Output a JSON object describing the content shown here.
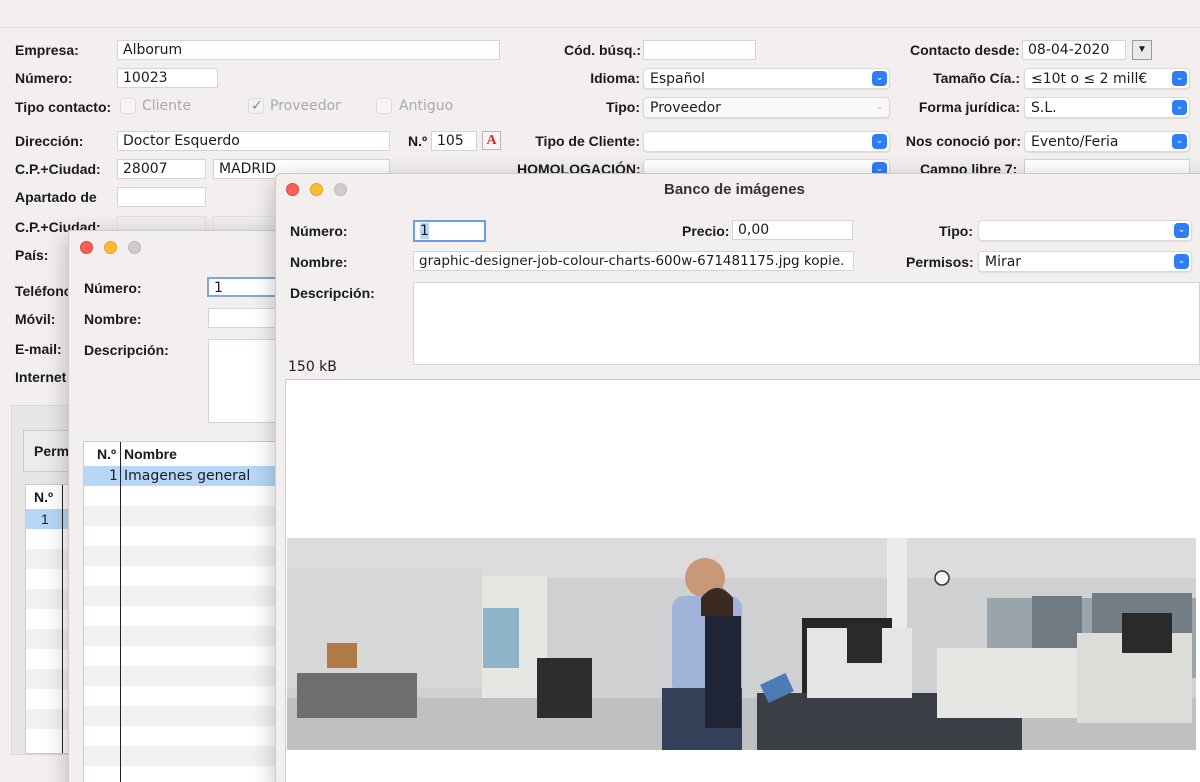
{
  "main_form": {
    "empresa_label": "Empresa:",
    "empresa_value": "Alborum",
    "numero_label": "Número:",
    "numero_value": "10023",
    "tipo_contacto_label": "Tipo contacto:",
    "cliente_label": "Cliente",
    "proveedor_label": "Proveedor",
    "antiguo_label": "Antiguo",
    "cod_busq_label": "Cód. búsq.:",
    "cod_busq_value": "",
    "idioma_label": "Idioma:",
    "idioma_value": "Español",
    "tipo_label": "Tipo:",
    "tipo_value": "Proveedor",
    "contacto_desde_label": "Contacto desde:",
    "contacto_desde_value": "08-04-2020",
    "tamano_label": "Tamaño Cía.:",
    "tamano_value": "≤10t o ≤ 2 mill€",
    "forma_juridica_label": "Forma jurídica:",
    "forma_juridica_value": "S.L.",
    "direccion_label": "Dirección:",
    "direccion_value": "Doctor Esquerdo",
    "numero_calle_label": "N.º",
    "numero_calle_value": "105",
    "tipo_cliente_label": "Tipo de Cliente:",
    "tipo_cliente_value": "",
    "nos_conocio_label": "Nos conoció por:",
    "nos_conocio_value": "Evento/Feria",
    "cp_ciudad_label": "C.P.+Ciudad:",
    "cp_value": "28007",
    "ciudad_value": "MADRID",
    "homologacion_label": "HOMOLOGACIÓN:",
    "campo_libre_label": "Campo libre 7:",
    "apartado_label": "Apartado de",
    "cp_ciudad2_label": "C.P.+Ciudad:",
    "pais_label": "País:",
    "telefono_label": "Teléfono",
    "movil_label": "Móvil:",
    "email_label": "E-mail:",
    "internet_label": "Internet",
    "tab_label": "Perm",
    "table_num_header": "N.º",
    "table_row1": "1"
  },
  "mid_window": {
    "numero_label": "Número:",
    "numero_value": "1",
    "nombre_label": "Nombre:",
    "nombre_value": "",
    "descripcion_label": "Descripción:",
    "col_num": "N.º",
    "col_nombre": "Nombre",
    "rows": [
      {
        "num": "1",
        "nombre": "Imagenes general"
      }
    ]
  },
  "image_window": {
    "title": "Banco de imágenes",
    "numero_label": "Número:",
    "numero_value": "1",
    "precio_label": "Precio:",
    "precio_value": "0,00",
    "tipo_label": "Tipo:",
    "tipo_value": "",
    "nombre_label": "Nombre:",
    "nombre_value": "graphic-designer-job-colour-charts-600w-671481175.jpg kopie.",
    "permisos_label": "Permisos:",
    "permisos_value": "Mirar",
    "descripcion_label": "Descripción:",
    "size_label": "150 kB"
  },
  "colors": {
    "accent": "#2f7df6",
    "selection": "#b6d7f7",
    "error_icon": "#d9262b"
  },
  "icons": [
    "calendar-dropdown-icon",
    "font-style-icon",
    "chevron-down-icon",
    "close-window-icon",
    "minimize-window-icon",
    "zoom-window-icon"
  ]
}
